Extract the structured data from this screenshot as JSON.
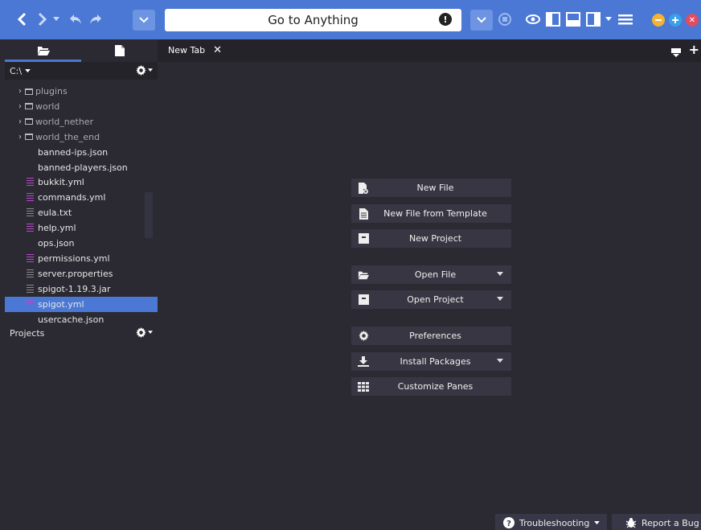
{
  "toolbar": {
    "goto_placeholder": "Go to Anything",
    "goto_alert": "!"
  },
  "sidebar": {
    "path": "C:\\",
    "items": [
      {
        "label": "plugins",
        "kind": "folder"
      },
      {
        "label": "world",
        "kind": "folder"
      },
      {
        "label": "world_nether",
        "kind": "folder"
      },
      {
        "label": "world_the_end",
        "kind": "folder"
      },
      {
        "label": "banned-ips.json",
        "kind": "plain"
      },
      {
        "label": "banned-players.json",
        "kind": "plain"
      },
      {
        "label": "bukkit.yml",
        "kind": "yml"
      },
      {
        "label": "commands.yml",
        "kind": "yml"
      },
      {
        "label": "eula.txt",
        "kind": "txt"
      },
      {
        "label": "help.yml",
        "kind": "yml"
      },
      {
        "label": "ops.json",
        "kind": "plain"
      },
      {
        "label": "permissions.yml",
        "kind": "yml"
      },
      {
        "label": "server.properties",
        "kind": "txt"
      },
      {
        "label": "spigot-1.19.3.jar",
        "kind": "txt"
      },
      {
        "label": "spigot.yml",
        "kind": "yml",
        "selected": true
      },
      {
        "label": "usercache.json",
        "kind": "plain"
      }
    ],
    "projects_label": "Projects"
  },
  "editor": {
    "tab_label": "New Tab",
    "tab_close": "✕"
  },
  "quickstart": [
    {
      "label": "New File",
      "icon": "new-file-icon",
      "dropdown": false
    },
    {
      "label": "New File from Template",
      "icon": "template-file-icon",
      "dropdown": false
    },
    {
      "label": "New Project",
      "icon": "project-icon",
      "dropdown": false
    },
    {
      "label": "Open File",
      "icon": "folder-open-icon",
      "dropdown": true
    },
    {
      "label": "Open Project",
      "icon": "project-icon",
      "dropdown": true
    },
    {
      "label": "Preferences",
      "icon": "gear-icon",
      "dropdown": false
    },
    {
      "label": "Install Packages",
      "icon": "download-icon",
      "dropdown": true
    },
    {
      "label": "Customize Panes",
      "icon": "grid-icon",
      "dropdown": false
    }
  ],
  "status": {
    "troubleshooting": "Troubleshooting",
    "report_bug": "Report a Bug"
  },
  "colors": {
    "accent": "#4a78d4",
    "background": "#2b2a33",
    "yml_icon": "#b54ac9",
    "minimize": "#f5b335",
    "maximize": "#3aa1e8",
    "close": "#e24c60"
  }
}
